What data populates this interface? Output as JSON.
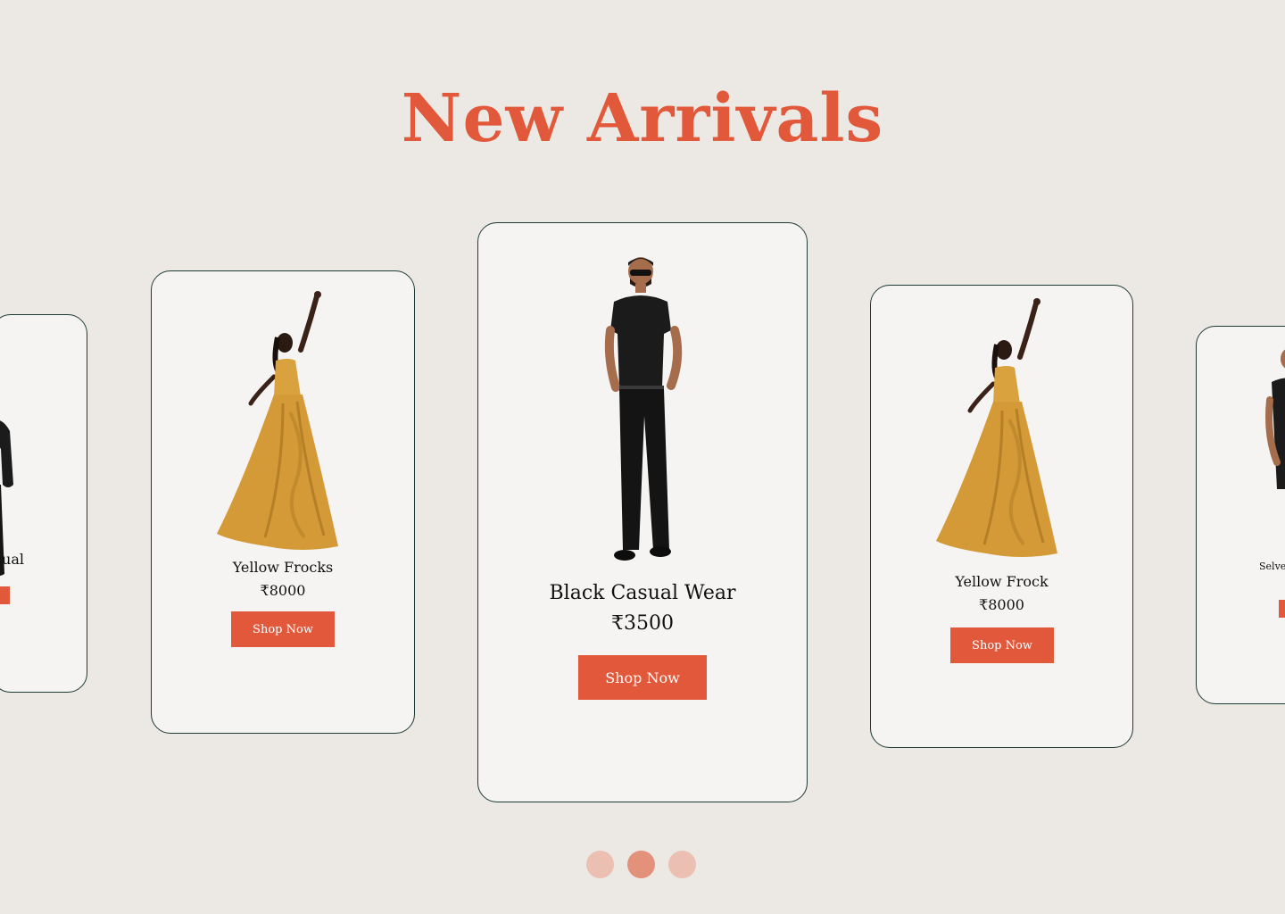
{
  "section": {
    "title": "New Arrivals"
  },
  "colors": {
    "accent": "#E2583A",
    "background": "#ECE9E4",
    "card_bg": "#F5F4F2",
    "card_border": "#1E3A34",
    "dot_inactive": "#EBC0B2",
    "dot_active": "#E4917C"
  },
  "cards": [
    {
      "name": "sual",
      "image": "man-black-outfit-image"
    },
    {
      "name": "Yellow Frocks",
      "price": "₹8000",
      "button": "Shop Now",
      "image": "yellow-frock-image"
    },
    {
      "name": "Black Casual Wear",
      "price": "₹3500",
      "button": "Shop Now",
      "image": "man-black-outfit-image"
    },
    {
      "name": "Yellow Frock",
      "price": "₹8000",
      "button": "Shop Now",
      "image": "yellow-frock-image"
    },
    {
      "name": "Selve",
      "image": "man-black-outfit-image"
    }
  ],
  "carousel": {
    "pages": 3,
    "active_index": 1
  }
}
